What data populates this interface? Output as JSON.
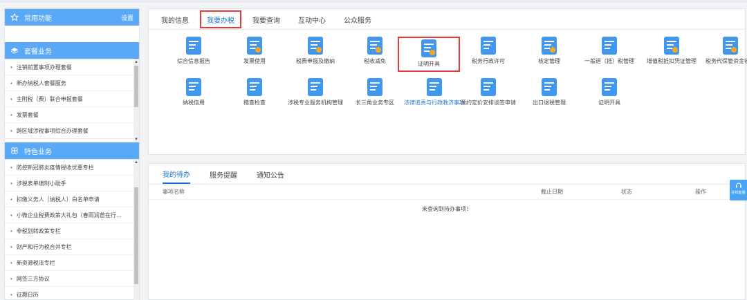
{
  "sidebar": {
    "common": {
      "title": "常用功能",
      "settings": "设置"
    },
    "package": {
      "title": "套餐业务",
      "items": [
        "注销前置事项办理套餐",
        "新办纳税人套餐服务",
        "主附税（费）联合申报套餐",
        "发票套餐",
        "跨区域涉税事项综合办理套餐"
      ]
    },
    "special": {
      "title": "特色业务",
      "items": [
        "防控新冠肺炎疫情税收优惠专栏",
        "涉税表单填制小助手",
        "扣缴义务人（纳税人）白名单申请",
        "小微企业税费政策大礼包（春雨润苗在行…",
        "非税划转政策专栏",
        "财产和行为税合并专栏",
        "新资源税法专栏",
        "网签三方协议",
        "征期日历"
      ]
    }
  },
  "tabs": [
    "我的信息",
    "我要办税",
    "我要查询",
    "互动中心",
    "公众服务"
  ],
  "active_tab": "我要办税",
  "functions": [
    {
      "label": "综合信息报告",
      "icon": "report-icon"
    },
    {
      "label": "发票使用",
      "icon": "invoice-icon"
    },
    {
      "label": "税费申报及缴纳",
      "icon": "declare-icon"
    },
    {
      "label": "税收减免",
      "icon": "tax-relief-icon"
    },
    {
      "label": "证明开具",
      "icon": "certificate-icon"
    },
    {
      "label": "税务行政许可",
      "icon": "license-icon"
    },
    {
      "label": "核定管理",
      "icon": "assessment-icon"
    },
    {
      "label": "一般退（抵）税管理",
      "icon": "refund-icon"
    },
    {
      "label": "增值税抵扣凭证管理",
      "icon": "vat-deduction-icon"
    },
    {
      "label": "税务代保管资金收取",
      "icon": "fund-custody-icon"
    },
    {
      "label": "纳税信用",
      "icon": "credit-icon"
    },
    {
      "label": "稽查检查",
      "icon": "inspection-icon"
    },
    {
      "label": "涉税专业服务机构管理",
      "icon": "agency-icon"
    },
    {
      "label": "长三角业务专区",
      "icon": "yangtze-delta-icon"
    },
    {
      "label": "法律追责与行政救济事项",
      "icon": "legal-icon"
    },
    {
      "label": "预约定价安排谈签申请",
      "icon": "pricing-icon"
    },
    {
      "label": "出口退税管理",
      "icon": "export-refund-icon"
    },
    {
      "label": "证明开具",
      "icon": "certificate2-icon"
    }
  ],
  "todo": {
    "tabs": [
      "我的待办",
      "服务提醒",
      "通知公告"
    ],
    "columns": {
      "name": "事项名称",
      "deadline": "截止日期",
      "status": "状态",
      "action": "操作"
    },
    "empty": "未查询到待办事项！"
  },
  "float_btn": "在线客服",
  "colors": {
    "accent": "#5aa9f6",
    "link": "#1b75d0",
    "highlight": "#e53935"
  }
}
